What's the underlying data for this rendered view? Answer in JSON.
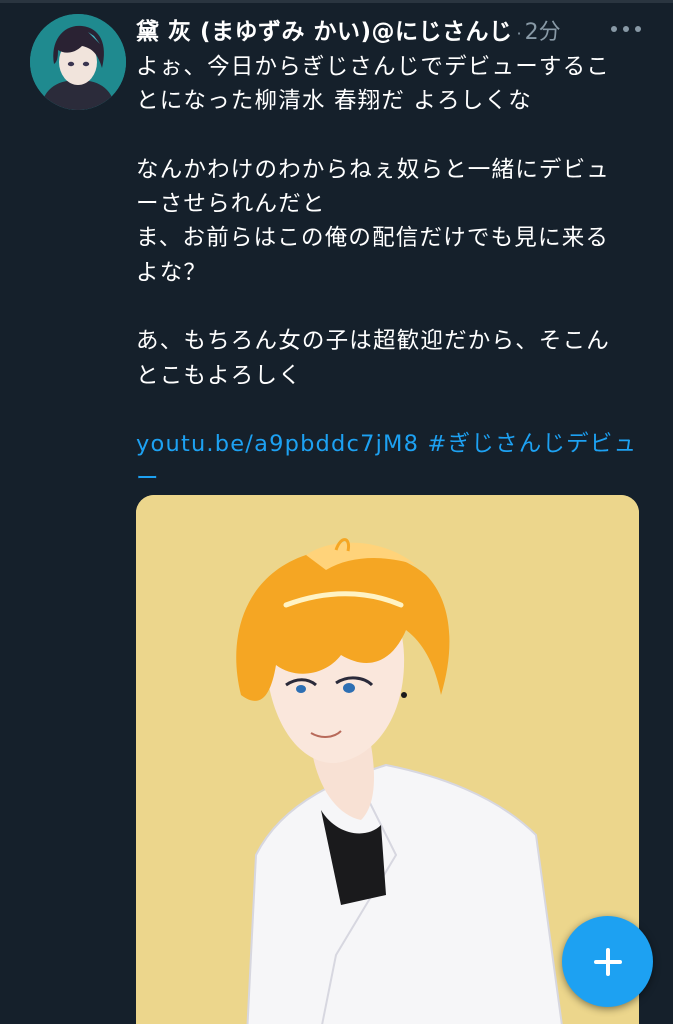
{
  "tweet": {
    "author_name": "黛 灰 (まゆずみ かい)@にじさんじ",
    "separator": "·",
    "timestamp": "2分",
    "body_lines": [
      "よぉ、今日からぎじさんじでデビューするこ",
      "とになった柳清水 春翔だ よろしくな",
      "",
      "なんかわけのわからねぇ奴らと一緒にデビュ",
      "ーさせられんだと",
      "ま、お前らはこの俺の配信だけでも見に来る",
      "よな？",
      "",
      "あ、もちろん女の子は超歓迎だから、そこん",
      "とこもよろしく",
      ""
    ],
    "link_url": "youtu.be/a9pbddc7jM8",
    "hashtag_part1": "#ぎじさんじデビュ",
    "hashtag_part2": "ー"
  },
  "icons": {
    "more": "more-horizontal-icon",
    "compose": "plus-icon"
  },
  "colors": {
    "background": "#15202b",
    "link": "#1da1f2",
    "muted": "#8899a6",
    "media_background": "#ecd68c"
  }
}
